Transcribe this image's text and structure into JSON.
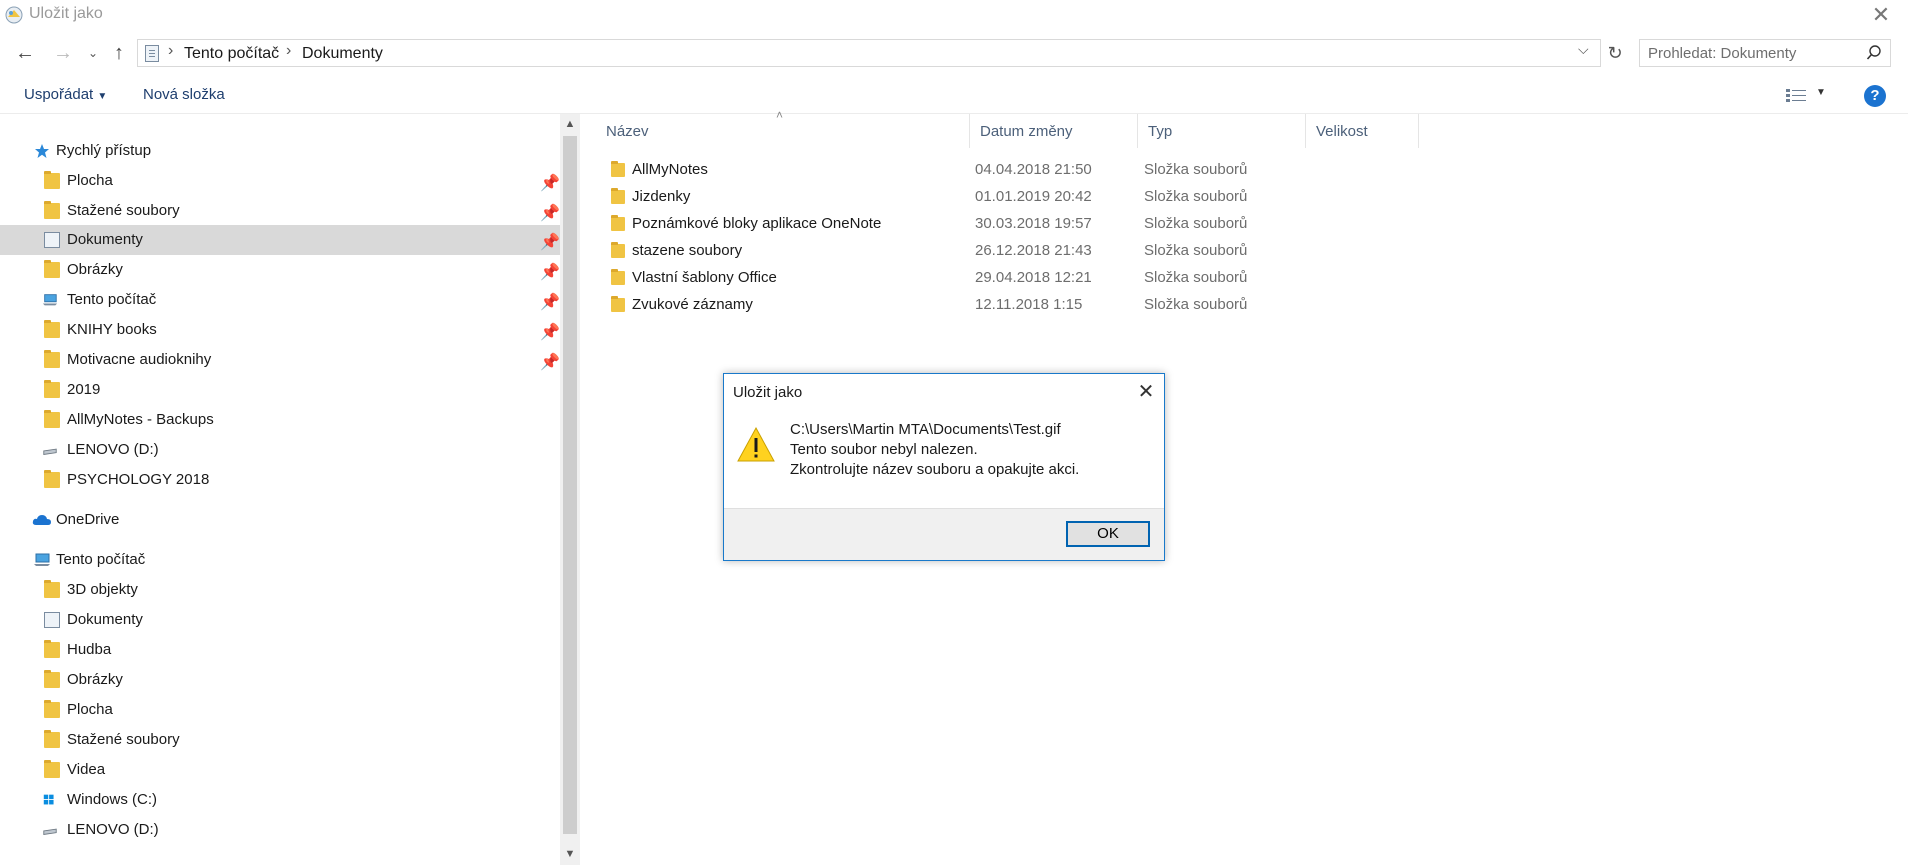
{
  "window": {
    "title": "Uložit jako"
  },
  "address": {
    "crumbs": [
      "Tento počítač",
      "Dokumenty"
    ]
  },
  "search": {
    "placeholder": "Prohledat: Dokumenty"
  },
  "toolbar": {
    "arrange_label": "Uspořádat",
    "new_folder_label": "Nová složka"
  },
  "sidebar": {
    "quick_access": "Rychlý přístup",
    "quick_items": [
      {
        "label": "Plocha",
        "icon": "desktop-folder-icon",
        "pinned": true
      },
      {
        "label": "Stažené soubory",
        "icon": "downloads-folder-icon",
        "pinned": true
      },
      {
        "label": "Dokumenty",
        "icon": "documents-folder-icon",
        "pinned": true,
        "selected": true
      },
      {
        "label": "Obrázky",
        "icon": "pictures-folder-icon",
        "pinned": true
      },
      {
        "label": "Tento počítač",
        "icon": "computer-icon",
        "pinned": true
      },
      {
        "label": "KNIHY books",
        "icon": "folder-icon",
        "pinned": true
      },
      {
        "label": "Motivacne audioknihy",
        "icon": "folder-icon",
        "pinned": true
      },
      {
        "label": "2019",
        "icon": "folder-icon",
        "pinned": false
      },
      {
        "label": "AllMyNotes - Backups",
        "icon": "folder-icon",
        "pinned": false
      },
      {
        "label": "LENOVO (D:)",
        "icon": "drive-icon",
        "pinned": false
      },
      {
        "label": "PSYCHOLOGY 2018",
        "icon": "folder-icon",
        "pinned": false
      }
    ],
    "onedrive": "OneDrive",
    "this_pc": "Tento počítač",
    "pc_items": [
      {
        "label": "3D objekty",
        "icon": "3d-objects-folder-icon"
      },
      {
        "label": "Dokumenty",
        "icon": "documents-folder-icon"
      },
      {
        "label": "Hudba",
        "icon": "music-folder-icon"
      },
      {
        "label": "Obrázky",
        "icon": "pictures-folder-icon"
      },
      {
        "label": "Plocha",
        "icon": "desktop-folder-icon"
      },
      {
        "label": "Stažené soubory",
        "icon": "downloads-folder-icon"
      },
      {
        "label": "Videa",
        "icon": "videos-folder-icon"
      },
      {
        "label": "Windows (C:)",
        "icon": "windows-drive-icon"
      },
      {
        "label": "LENOVO (D:)",
        "icon": "drive-icon"
      }
    ]
  },
  "files": {
    "columns": [
      "Název",
      "Datum změny",
      "Typ",
      "Velikost"
    ],
    "rows": [
      {
        "name": "AllMyNotes",
        "date": "04.04.2018 21:50",
        "type": "Složka souborů"
      },
      {
        "name": "Jizdenky",
        "date": "01.01.2019 20:42",
        "type": "Složka souborů"
      },
      {
        "name": "Poznámkové bloky aplikace OneNote",
        "date": "30.03.2018 19:57",
        "type": "Složka souborů"
      },
      {
        "name": "stazene soubory",
        "date": "26.12.2018 21:43",
        "type": "Složka souborů"
      },
      {
        "name": "Vlastní šablony Office",
        "date": "29.04.2018 12:21",
        "type": "Složka souborů"
      },
      {
        "name": "Zvukové záznamy",
        "date": "12.11.2018 1:15",
        "type": "Složka souborů"
      }
    ]
  },
  "dialog": {
    "title": "Uložit jako",
    "lines": [
      "C:\\Users\\Martin MTA\\Documents\\Test.gif",
      "Tento soubor nebyl nalezen.",
      "Zkontrolujte název souboru a opakujte akci."
    ],
    "ok_label": "OK"
  },
  "colors": {
    "accent": "#1979ca",
    "folder": "#f0c443",
    "selected_row": "#d9d9d9",
    "help": "#1b73d0"
  }
}
